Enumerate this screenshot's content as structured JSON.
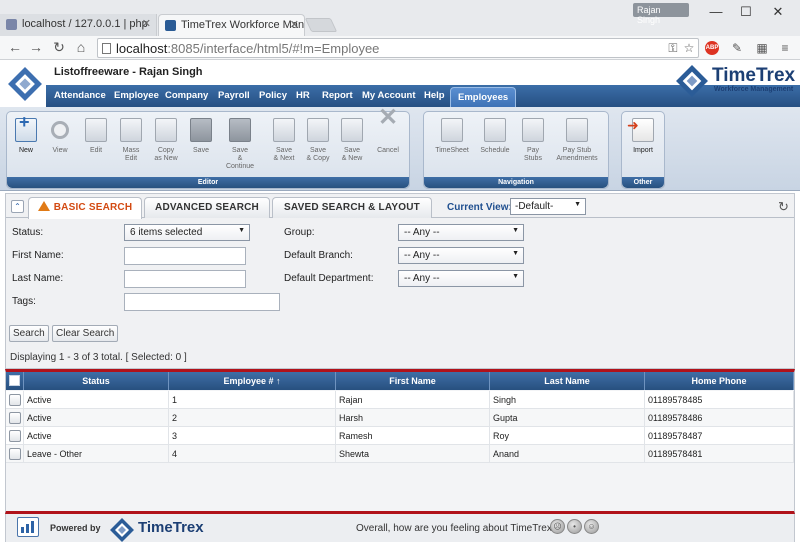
{
  "browser": {
    "tabs": [
      {
        "title": "localhost / 127.0.0.1 | php"
      },
      {
        "title": "TimeTrex Workforce Mana"
      }
    ],
    "user_badge": "Rajan Singh",
    "url_host": "localhost",
    "url_rest": ":8085/interface/html5/#!m=Employee",
    "ext_abp": "ABP"
  },
  "app": {
    "company_line": "Listoffreeware - Rajan Singh",
    "brand_name": "TimeTrex",
    "brand_sub": "Workforce Management",
    "menu": [
      "Attendance",
      "Employee",
      "Company",
      "Payroll",
      "Policy",
      "HR",
      "Report",
      "My Account",
      "Help"
    ],
    "active_menu": "Employees"
  },
  "ribbon": {
    "editor_title": "Editor",
    "navigation_title": "Navigation",
    "other_title": "Other",
    "editor_buttons": [
      {
        "l1": "New",
        "l2": ""
      },
      {
        "l1": "View",
        "l2": ""
      },
      {
        "l1": "Edit",
        "l2": ""
      },
      {
        "l1": "Mass",
        "l2": "Edit"
      },
      {
        "l1": "Copy",
        "l2": "as New"
      },
      {
        "l1": "Save",
        "l2": ""
      },
      {
        "l1": "Save",
        "l2": "& Continue"
      },
      {
        "l1": "Save",
        "l2": "& Next"
      },
      {
        "l1": "Save",
        "l2": "& Copy"
      },
      {
        "l1": "Save",
        "l2": "& New"
      },
      {
        "l1": "Cancel",
        "l2": ""
      }
    ],
    "nav_buttons": [
      {
        "l1": "TimeSheet",
        "l2": ""
      },
      {
        "l1": "Schedule",
        "l2": ""
      },
      {
        "l1": "Pay",
        "l2": "Stubs"
      },
      {
        "l1": "Pay Stub",
        "l2": "Amendments"
      }
    ],
    "other_buttons": [
      {
        "l1": "Import",
        "l2": ""
      }
    ]
  },
  "search": {
    "tabs": [
      "BASIC SEARCH",
      "ADVANCED SEARCH",
      "SAVED SEARCH & LAYOUT"
    ],
    "current_view_label": "Current View:",
    "current_view_value": "-Default-",
    "status_label": "Status:",
    "status_value": "6 items selected",
    "first_name_label": "First Name:",
    "first_name_value": "",
    "last_name_label": "Last Name:",
    "last_name_value": "",
    "tags_label": "Tags:",
    "tags_value": "",
    "group_label": "Group:",
    "group_value": "-- Any --",
    "branch_label": "Default Branch:",
    "branch_value": "-- Any --",
    "department_label": "Default Department:",
    "department_value": "-- Any --",
    "search_btn": "Search",
    "clear_btn": "Clear Search",
    "displaying": "Displaying 1 - 3 of 3 total. [ Selected: 0 ]"
  },
  "grid": {
    "columns": [
      "Status",
      "Employee # ↑",
      "First Name",
      "Last Name",
      "Home Phone"
    ],
    "rows": [
      {
        "status": "Active",
        "emp": "1",
        "first": "Rajan",
        "last": "Singh",
        "phone": "01189578485"
      },
      {
        "status": "Active",
        "emp": "2",
        "first": "Harsh",
        "last": "Gupta",
        "phone": "01189578486"
      },
      {
        "status": "Active",
        "emp": "3",
        "first": "Ramesh",
        "last": "Roy",
        "phone": "01189578487"
      },
      {
        "status": "Leave - Other",
        "emp": "4",
        "first": "Shewta",
        "last": "Anand",
        "phone": "01189578481"
      }
    ]
  },
  "footer": {
    "powered_by": "Powered by",
    "brand": "TimeTrex",
    "feeling": "Overall, how are you feeling about TimeTrex?"
  },
  "colors": {
    "accent": "#2b5c97",
    "active_tab_text": "#d34a12",
    "grid_border": "#b0121a"
  }
}
